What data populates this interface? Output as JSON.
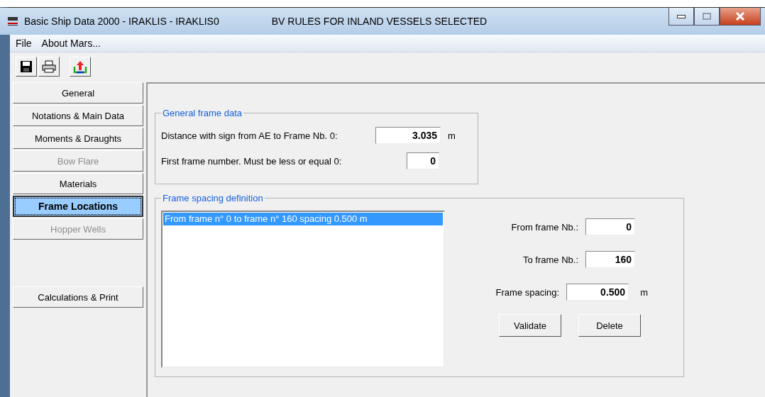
{
  "window": {
    "title": "Basic Ship Data 2000 - IRAKLIS - IRAKLIS0",
    "status": "BV RULES FOR INLAND VESSELS SELECTED"
  },
  "menu": [
    "File",
    "About Mars..."
  ],
  "toolbar": [
    {
      "kind": "save"
    },
    {
      "kind": "print"
    },
    {
      "kind": "export"
    }
  ],
  "sidebar": {
    "items": [
      {
        "label": "General",
        "selected": false,
        "disabled": false
      },
      {
        "label": "Notations & Main Data",
        "selected": false,
        "disabled": false
      },
      {
        "label": "Moments & Draughts",
        "selected": false,
        "disabled": false
      },
      {
        "label": "Bow Flare",
        "selected": false,
        "disabled": true
      },
      {
        "label": "Materials",
        "selected": false,
        "disabled": false
      },
      {
        "label": "Frame Locations",
        "selected": true,
        "disabled": false
      },
      {
        "label": "Hopper Wells",
        "selected": false,
        "disabled": true
      }
    ],
    "bottom": {
      "label": "Calculations & Print",
      "selected": false,
      "disabled": false
    }
  },
  "general_frame_data": {
    "title": "General frame data",
    "fields": [
      {
        "label": "Distance with sign from AE to Frame Nb. 0:",
        "value": "3.035",
        "unit": "m"
      },
      {
        "label": "First frame number. Must be less or equal 0:",
        "value": "0"
      }
    ]
  },
  "frame_spacing": {
    "title": "Frame spacing definition",
    "list": [
      {
        "text": "From frame n° 0 to frame n° 160 spacing 0.500 m",
        "selected": true
      }
    ],
    "fields": [
      {
        "label": "From frame Nb.:",
        "value": "0"
      },
      {
        "label": "To frame Nb.:",
        "value": "160"
      },
      {
        "label": "Frame spacing:",
        "value": "0.500",
        "unit": "m"
      }
    ],
    "buttons": [
      "Validate",
      "Delete"
    ]
  }
}
